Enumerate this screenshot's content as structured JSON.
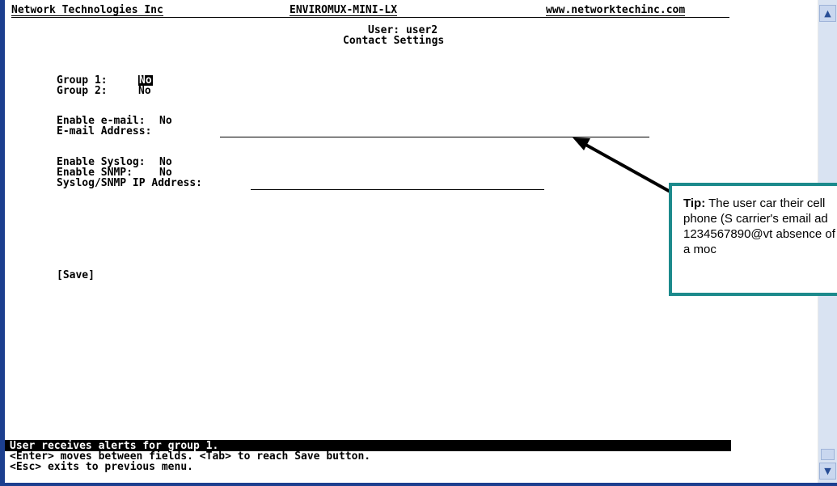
{
  "header": {
    "company": "Network Technologies Inc",
    "product": "ENVIROMUX-MINI-LX",
    "website": "www.networktechinc.com"
  },
  "page": {
    "user_line": "User: user2",
    "title": "Contact Settings"
  },
  "fields": {
    "group1_label": "Group 1:",
    "group1_value": "No",
    "group2_label": "Group 2:",
    "group2_value": "No",
    "enable_email_label": "Enable e-mail:",
    "enable_email_value": "No",
    "email_address_label": "E-mail Address:",
    "email_address_value": "",
    "enable_syslog_label": "Enable Syslog:",
    "enable_syslog_value": "No",
    "enable_snmp_label": "Enable SNMP:",
    "enable_snmp_value": "No",
    "syslog_snmp_ip_label": "Syslog/SNMP IP Address:",
    "syslog_snmp_ip_value": ""
  },
  "save_button": "[Save]",
  "status": {
    "line1": "User receives alerts for group 1.",
    "line2": "<Enter> moves between fields. <Tab> to reach Save button.",
    "line3": "<Esc> exits to previous menu."
  },
  "tip": {
    "label": "Tip:",
    "text": "The user car their cell phone (S carrier's email ad 1234567890@vt absence of a moc"
  },
  "colors": {
    "frame": "#1c3f8f",
    "tip_border": "#1c8a8c",
    "scrollbar": "#d9e3f2"
  },
  "icons": {
    "scroll_up": "chevron-up-icon",
    "scroll_down": "chevron-down-icon"
  }
}
